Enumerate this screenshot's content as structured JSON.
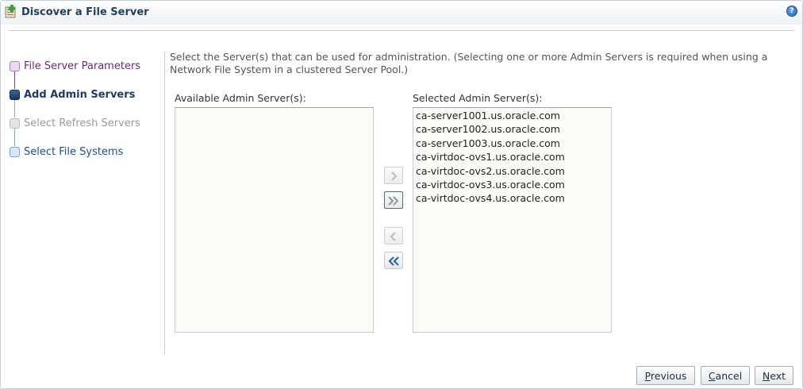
{
  "dialog": {
    "title": "Discover a File Server",
    "help_icon": "question-mark-icon"
  },
  "train": {
    "steps": [
      {
        "label": "File Server Parameters",
        "state": "visited",
        "color": "#6b2a78"
      },
      {
        "label": "Add Admin Servers",
        "state": "current",
        "color": "#1e3a66"
      },
      {
        "label": "Select Refresh Servers",
        "state": "disabled",
        "color": "#9a9a9a"
      },
      {
        "label": "Select File Systems",
        "state": "unvisited",
        "color": "#1f4f8f"
      }
    ]
  },
  "instructions": "Select the Server(s) that can be used for administration. (Selecting one or more Admin Servers is required when using a Network File System in a clustered Server Pool.)",
  "shuttle": {
    "available_label": "Available Admin Server(s):",
    "available_items": [],
    "selected_label": "Selected Admin Server(s):",
    "selected_items": [
      "ca-server1001.us.oracle.com",
      "ca-server1002.us.oracle.com",
      "ca-server1003.us.oracle.com",
      "ca-virtdoc-ovs1.us.oracle.com",
      "ca-virtdoc-ovs2.us.oracle.com",
      "ca-virtdoc-ovs3.us.oracle.com",
      "ca-virtdoc-ovs4.us.oracle.com"
    ],
    "buttons": {
      "move": {
        "icon": "move-right-icon",
        "enabled": false
      },
      "move_all": {
        "icon": "move-all-right-icon",
        "enabled": true
      },
      "remove": {
        "icon": "move-left-icon",
        "enabled": false
      },
      "remove_all": {
        "icon": "move-all-left-icon",
        "enabled": true
      }
    }
  },
  "footer": {
    "previous": {
      "first": "P",
      "rest": "revious"
    },
    "cancel": {
      "first": "C",
      "rest": "ancel"
    },
    "next": {
      "first": "N",
      "rest": "ext"
    }
  }
}
